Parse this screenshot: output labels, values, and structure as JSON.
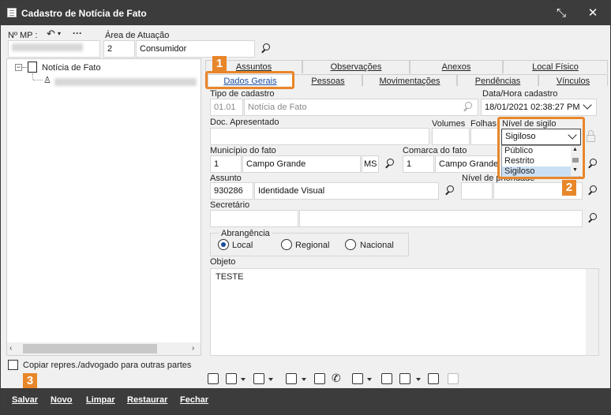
{
  "window": {
    "title": "Cadastro de Notícia de Fato"
  },
  "header": {
    "mp_label": "Nº MP :",
    "area_label": "Área de Atuação",
    "area_code": "2",
    "area_name": "Consumidor"
  },
  "tree": {
    "root_label": "Notícia de Fato"
  },
  "tabs_row1": [
    {
      "label": "Assuntos"
    },
    {
      "label": "Observações"
    },
    {
      "label": "Anexos"
    },
    {
      "label": "Local Físico"
    }
  ],
  "tabs_row2": [
    {
      "label": "Dados Gerais"
    },
    {
      "label": "Pessoas"
    },
    {
      "label": "Movimentações"
    },
    {
      "label": "Pendências"
    },
    {
      "label": "Vínculos"
    }
  ],
  "form": {
    "tipo_label": "Tipo de cadastro",
    "tipo_code": "01.01",
    "tipo_name": "Notícia de Fato",
    "data_label": "Data/Hora cadastro",
    "data_value": "18/01/2021 02:38:27 PM",
    "doc_label": "Doc. Apresentado",
    "volumes_label": "Volumes",
    "folhas_label": "Folhas",
    "sigilo_label": "Nível de sigilo",
    "sigilo_value": "Sigiloso",
    "sigilo_options": [
      "Público",
      "Restrito",
      "Sigiloso"
    ],
    "municipio_label": "Município do fato",
    "municipio_code": "1",
    "municipio_name": "Campo Grande",
    "municipio_uf": "MS",
    "comarca_label": "Comarca do fato",
    "comarca_code": "1",
    "comarca_name": "Campo Grande",
    "assunto_label": "Assunto",
    "assunto_code": "930286",
    "assunto_name": "Identidade Visual",
    "prioridade_label": "Nível de prioridade",
    "secretario_label": "Secretário",
    "abrangencia_label": "Abrangência",
    "abrangencia_options": [
      "Local",
      "Regional",
      "Nacional"
    ],
    "objeto_label": "Objeto",
    "objeto_value": "TESTE"
  },
  "copy_checkbox_label": "Copiar repres./advogado para outras partes",
  "badges": [
    "1",
    "2",
    "3"
  ],
  "actions": {
    "salvar": "Salvar",
    "novo": "Novo",
    "limpar": "Limpar",
    "restaurar": "Restaurar",
    "fechar": "Fechar"
  },
  "colors": {
    "accent": "#e8862a",
    "titlebar": "#3c3c3c",
    "selection": "#cce0f4"
  }
}
